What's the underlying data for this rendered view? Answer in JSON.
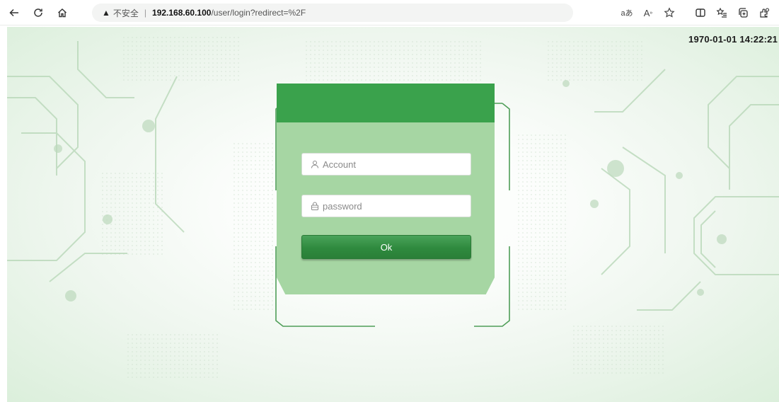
{
  "browser": {
    "insecure_label": "不安全",
    "separator": "|",
    "url_host": "192.168.60.100",
    "url_path": "/user/login?redirect=%2F",
    "read_aloud_label": "aあ",
    "text_size_label": "A",
    "icons": {
      "back": "back-arrow-icon",
      "refresh": "refresh-icon",
      "home": "home-icon",
      "warning": "warning-triangle-icon",
      "favorite": "star-icon",
      "split_screen": "split-screen-icon",
      "favorites": "favorites-list-icon",
      "collections": "collections-icon",
      "extensions": "extensions-icon"
    }
  },
  "page": {
    "clock": "1970-01-01 14:22:21",
    "login": {
      "account_placeholder": "Account",
      "password_placeholder": "password",
      "ok_label": "Ok"
    }
  },
  "colors": {
    "header_green": "#3aa24c",
    "panel_green": "#a6d6a3",
    "button_green": "#2f8a3e"
  }
}
